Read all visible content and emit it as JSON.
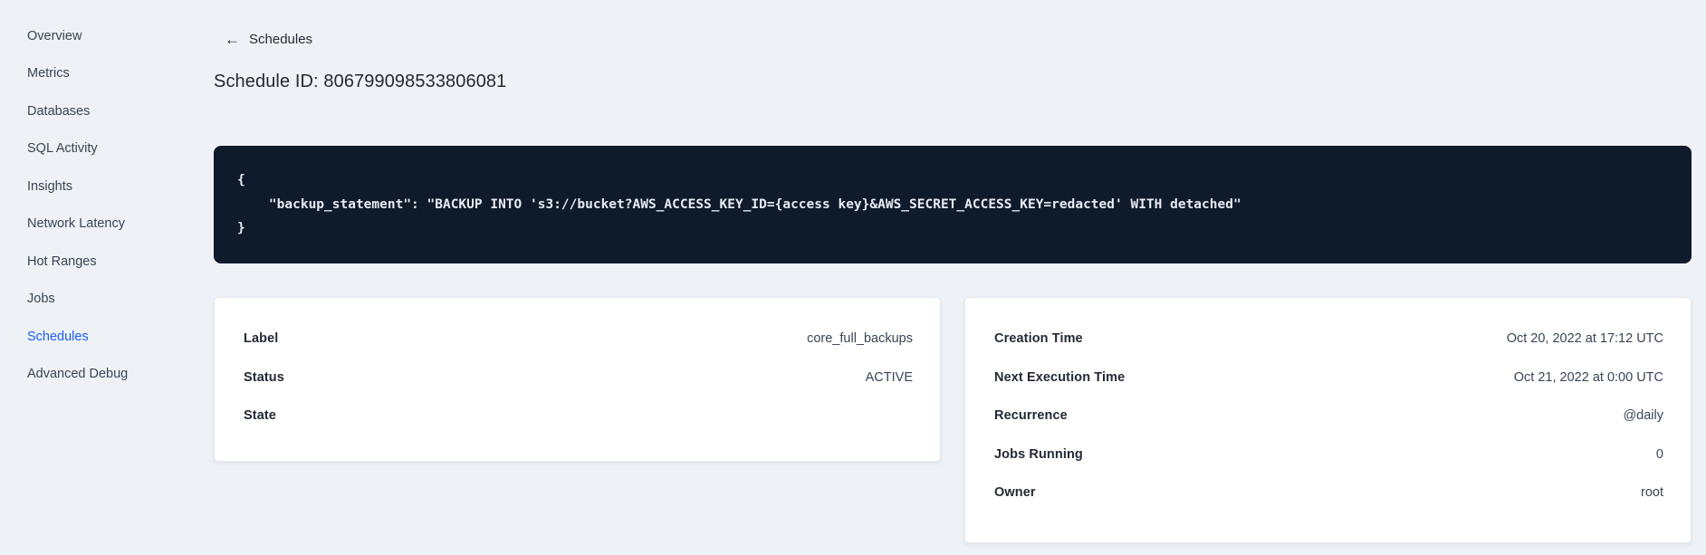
{
  "sidebar": {
    "items": [
      {
        "label": "Overview"
      },
      {
        "label": "Metrics"
      },
      {
        "label": "Databases"
      },
      {
        "label": "SQL Activity"
      },
      {
        "label": "Insights"
      },
      {
        "label": "Network Latency"
      },
      {
        "label": "Hot Ranges"
      },
      {
        "label": "Jobs"
      },
      {
        "label": "Schedules",
        "active": true
      },
      {
        "label": "Advanced Debug"
      }
    ]
  },
  "header": {
    "back_label": "Schedules",
    "back_icon": "←",
    "title": "Schedule ID: 806799098533806081"
  },
  "code": {
    "lines": [
      "{",
      "    \"backup_statement\": \"BACKUP INTO 's3://bucket?AWS_ACCESS_KEY_ID={access key}&AWS_SECRET_ACCESS_KEY=redacted' WITH detached\"",
      "}"
    ]
  },
  "details_card": {
    "rows": [
      {
        "label": "Label",
        "value": "core_full_backups"
      },
      {
        "label": "Status",
        "value": "ACTIVE"
      },
      {
        "label": "State",
        "value": ""
      }
    ]
  },
  "schedule_card": {
    "rows": [
      {
        "label": "Creation Time",
        "value": "Oct 20, 2022 at 17:12 UTC"
      },
      {
        "label": "Next Execution Time",
        "value": "Oct 21, 2022 at 0:00 UTC"
      },
      {
        "label": "Recurrence",
        "value": "@daily"
      },
      {
        "label": "Jobs Running",
        "value": "0"
      },
      {
        "label": "Owner",
        "value": "root"
      }
    ]
  },
  "colors": {
    "page_bg": "#eef2f6",
    "accent_link": "#1a5cf5",
    "code_bg": "#0f1a2b",
    "code_text": "#e6ebf3"
  }
}
